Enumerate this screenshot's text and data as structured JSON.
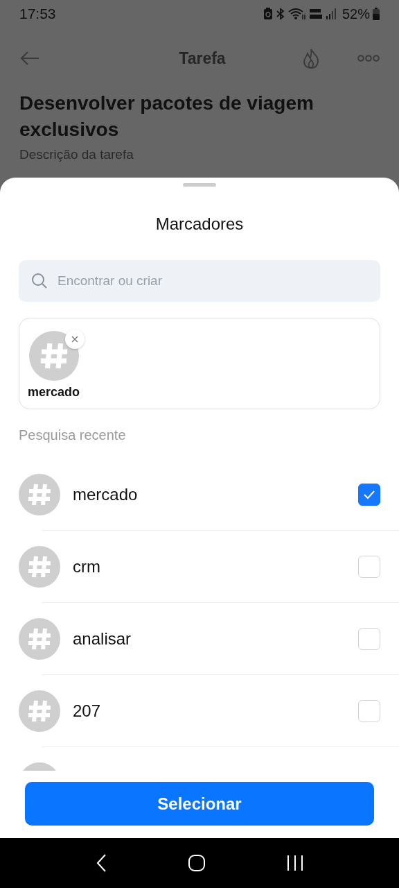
{
  "status_bar": {
    "time": "17:53",
    "battery": "52%"
  },
  "app_bar": {
    "title": "Tarefa"
  },
  "task": {
    "title": "Desenvolver pacotes de viagem exclusivos",
    "description_label": "Descrição da tarefa"
  },
  "sheet": {
    "title": "Marcadores",
    "search": {
      "placeholder": "Encontrar ou criar"
    },
    "selected_tags": [
      {
        "label": "mercado"
      }
    ],
    "recent_label": "Pesquisa recente",
    "tags": [
      {
        "label": "mercado",
        "checked": true
      },
      {
        "label": "crm",
        "checked": false
      },
      {
        "label": "analisar",
        "checked": false
      },
      {
        "label": "207",
        "checked": false
      }
    ],
    "button": "Selecionar"
  }
}
